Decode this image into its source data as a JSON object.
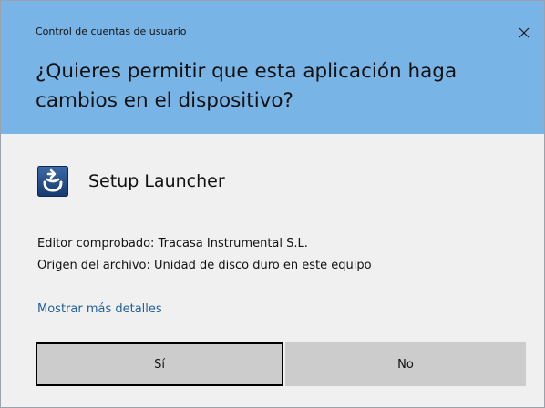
{
  "window": {
    "caption": "Control de cuentas de usuario",
    "close_icon": "close-icon"
  },
  "prompt": {
    "question": "¿Quieres permitir que esta aplicación haga cambios en el dispositivo?"
  },
  "app": {
    "name": "Setup Launcher",
    "icon": "installer-icon",
    "publisher": "Editor comprobado: Tracasa Instrumental S.L.",
    "origin": "Origen del archivo: Unidad de disco duro en este equipo"
  },
  "links": {
    "more_details": "Mostrar más detalles"
  },
  "buttons": {
    "yes": "Sí",
    "no": "No"
  },
  "colors": {
    "header_background": "#78b4e6",
    "body_background": "#f0f0f0",
    "button_background": "#cccccc",
    "link": "#1f5f99"
  }
}
